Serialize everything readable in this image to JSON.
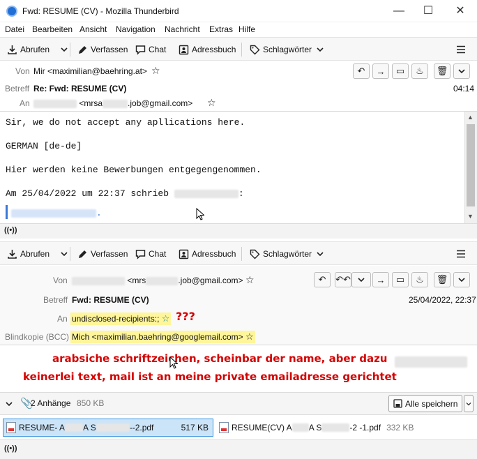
{
  "window": {
    "title": "Fwd: RESUME (CV) - Mozilla Thunderbird",
    "minimize": "—",
    "maximize": "☐",
    "close": "✕"
  },
  "menu": {
    "items": [
      "Datei",
      "Bearbeiten",
      "Ansicht",
      "Navigation",
      "Nachricht",
      "Extras",
      "Hilfe"
    ]
  },
  "toolbar": {
    "get_mail": "Abrufen",
    "write": "Verfassen",
    "chat": "Chat",
    "address_book": "Adressbuch",
    "tags": "Schlagwörter"
  },
  "message1": {
    "from_label": "Von",
    "from_value": "Mir <maximilian@baehring.at>",
    "subject_label": "Betreff",
    "subject_value": "Re: Fwd: RESUME (CV)",
    "time": "04:14",
    "to_label": "An",
    "to_value_suffix": "<mrsa",
    "to_value_end": ".job@gmail.com>",
    "body_lines": [
      "Sir, we do not accept any apllications here.",
      "GERMAN [de-de]",
      "Hier werden keine Bewerbungen entgegengenommen.",
      "Am 25/04/2022 um 22:37 schrieb"
    ],
    "body_colon": ":",
    "quote_end": "."
  },
  "message2": {
    "from_label": "Von",
    "from_value_mid": "<mrs",
    "from_value_end": ".job@gmail.com>",
    "subject_label": "Betreff",
    "subject_value": "Fwd: RESUME (CV)",
    "datetime": "25/04/2022, 22:37",
    "to_label": "An",
    "to_value": "undisclosed-recipients:;",
    "bcc_label": "Blindkopie (BCC)",
    "bcc_value": "Mich <maximilian.baehring@googlemail.com>"
  },
  "annotations": {
    "question": "???",
    "line1": "arabsiche schriftzeichen, scheinbar der name,  aber dazu",
    "line2": "keinerlei text, mail ist an meine private emailadresse gerichtet"
  },
  "attachments": {
    "summary": "2 Anhänge",
    "total_size": "850 KB",
    "save_all": "Alle speichern",
    "items": [
      {
        "name": "RESUME- A",
        "name_end": "--2.pdf",
        "mid": "A S",
        "size": "517 KB"
      },
      {
        "name": "RESUME(CV) A",
        "name_end": "-2 -1.pdf",
        "mid": "A S",
        "size": "332 KB"
      }
    ]
  },
  "colors": {
    "highlight": "#fff59a",
    "annotation": "#d40000",
    "quote_blue": "#3b78d8"
  }
}
